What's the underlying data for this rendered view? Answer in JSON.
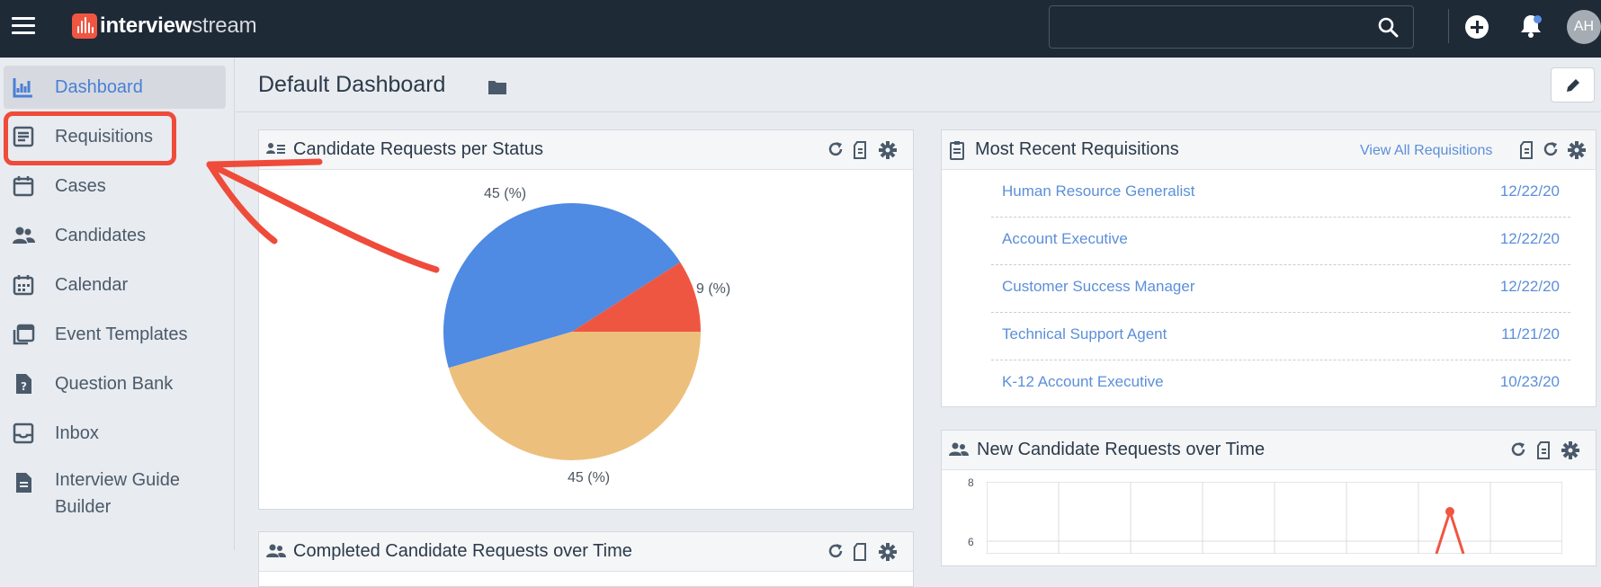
{
  "app": {
    "logo_bold": "interview",
    "logo_light": "stream",
    "search": {
      "placeholder": ""
    },
    "user_initials": "AH"
  },
  "sidebar": {
    "items": [
      {
        "label": "Dashboard",
        "icon": "chart-icon"
      },
      {
        "label": "Requisitions",
        "icon": "list-icon"
      },
      {
        "label": "Cases",
        "icon": "calendar-icon"
      },
      {
        "label": "Candidates",
        "icon": "people-icon"
      },
      {
        "label": "Calendar",
        "icon": "calendar-grid-icon"
      },
      {
        "label": "Event Templates",
        "icon": "template-icon"
      },
      {
        "label": "Question Bank",
        "icon": "question-file-icon"
      },
      {
        "label": "Inbox",
        "icon": "inbox-icon"
      },
      {
        "label": "Interview Guide",
        "label2": "Builder",
        "icon": "document-icon"
      }
    ]
  },
  "header": {
    "title": "Default Dashboard"
  },
  "status_panel": {
    "title": "Candidate Requests per Status",
    "labels": {
      "top": "45 (%)",
      "right": "9 (%)",
      "bottom": "45 (%)"
    }
  },
  "chart_data": [
    {
      "type": "pie",
      "title": "Candidate Requests per Status",
      "slices": [
        {
          "value": 45,
          "label": "45 (%)",
          "color": "#4f8ae3"
        },
        {
          "value": 9,
          "label": "9 (%)",
          "color": "#ef5641"
        },
        {
          "value": 45,
          "label": "45 (%)",
          "color": "#ecc07c"
        }
      ]
    },
    {
      "type": "line",
      "title": "New Candidate Requests over Time",
      "ytick_labels": [
        "8",
        "6"
      ],
      "series": [
        {
          "values": [
            7
          ],
          "color": "#ef5641"
        }
      ]
    }
  ],
  "requisitions_panel": {
    "title": "Most Recent Requisitions",
    "view_all": "View All Requisitions",
    "rows": [
      {
        "name": "Human Resource Generalist",
        "date": "12/22/20"
      },
      {
        "name": "Account Executive",
        "date": "12/22/20"
      },
      {
        "name": "Customer Success Manager",
        "date": "12/22/20"
      },
      {
        "name": "Technical Support Agent",
        "date": "11/21/20"
      },
      {
        "name": "K-12 Account Executive",
        "date": "10/23/20"
      }
    ]
  },
  "time_panel": {
    "title": "New Candidate Requests over Time",
    "y8": "8",
    "y6": "6"
  },
  "completed_panel": {
    "title": "Completed Candidate Requests over Time"
  },
  "colors": {
    "topbar": "#1f2a37",
    "accent": "#4f8ae3",
    "annotation": "#ef4b3a"
  }
}
